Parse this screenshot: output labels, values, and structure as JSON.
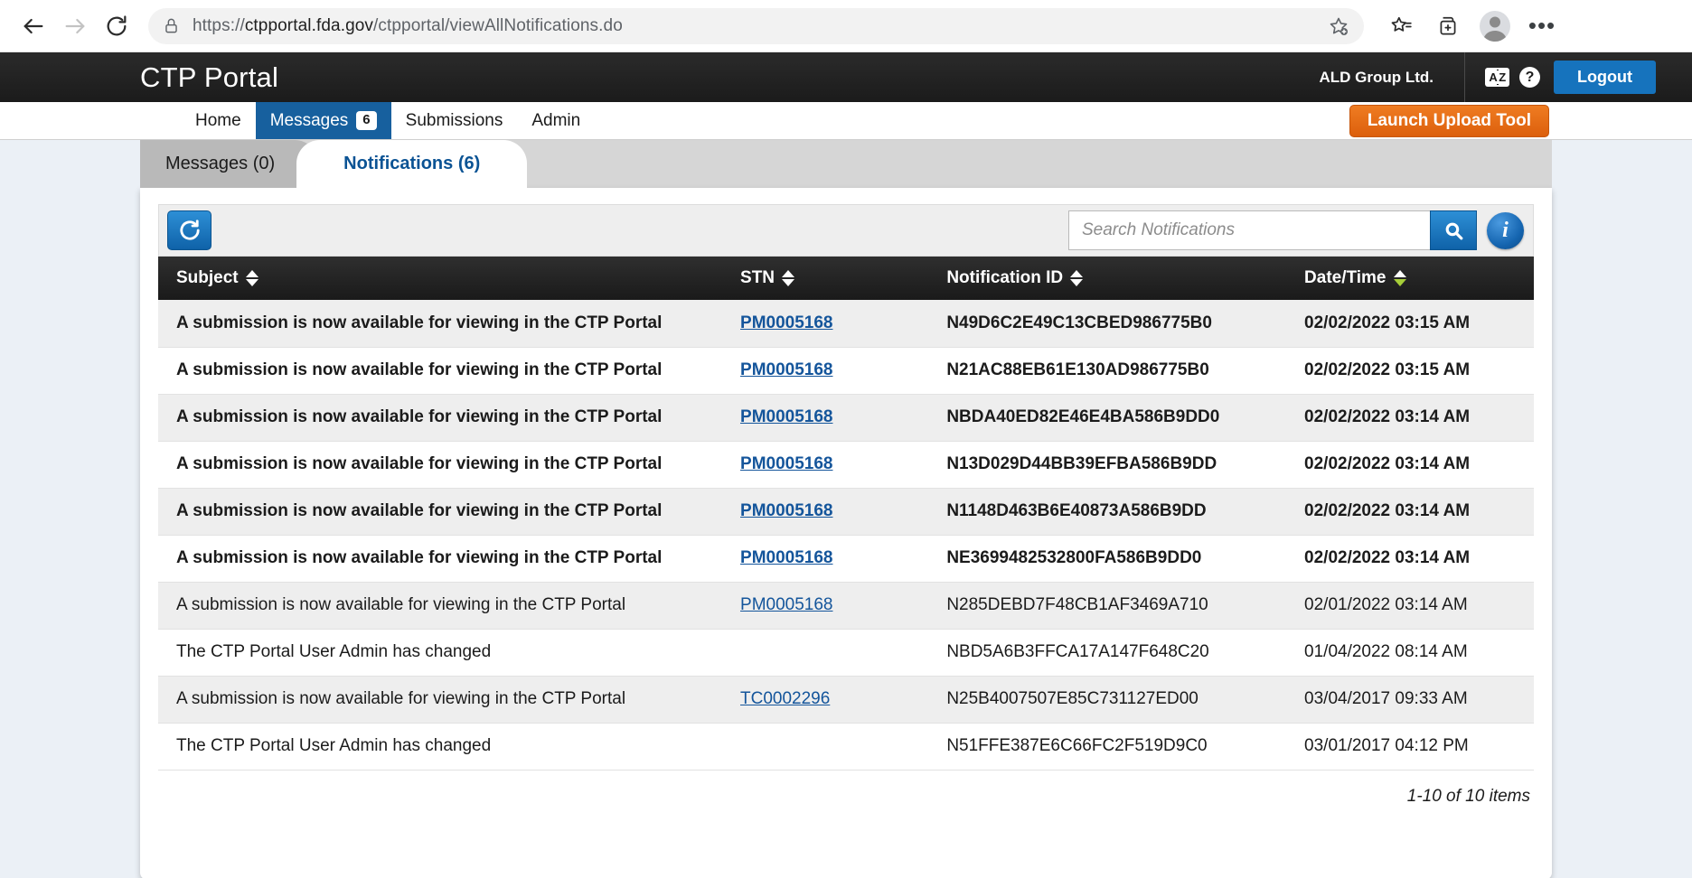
{
  "browser": {
    "url_scheme": "https://",
    "url_host": "ctpportal.fda.gov",
    "url_path": "/ctpportal/viewAllNotifications.do",
    "back_icon": "back-arrow-icon",
    "forward_icon": "forward-arrow-icon",
    "reload_icon": "reload-icon",
    "lock_icon": "lock-icon",
    "add_favorite_icon": "add-favorite-star-icon",
    "favorites_icon": "favorites-list-icon",
    "collections_icon": "collections-icon",
    "profile_icon": "profile-avatar-icon",
    "settings_icon": "more-options-ellipsis-icon",
    "settings_label": "•••"
  },
  "header": {
    "app_title": "CTP Portal",
    "org_name": "ALD Group Ltd.",
    "glossary_icon_label": "AZ",
    "glossary_icon_a": "A",
    "glossary_icon_z": "Z",
    "help_icon_label": "?",
    "logout_label": "Logout",
    "logo_color": "#1b1b1b",
    "logout_color": "#1673bd"
  },
  "nav": {
    "items": [
      {
        "label": "Home",
        "badge": null,
        "active": false
      },
      {
        "label": "Messages",
        "badge": "6",
        "active": true
      },
      {
        "label": "Submissions",
        "badge": null,
        "active": false
      },
      {
        "label": "Admin",
        "badge": null,
        "active": false
      }
    ],
    "upload_button_label": "Launch Upload Tool",
    "upload_button_color": "#e2690f",
    "active_color": "#17609e"
  },
  "tabs": [
    {
      "label": "Messages (0)",
      "active": false
    },
    {
      "label": "Notifications (6)",
      "active": true
    }
  ],
  "toolbar": {
    "refresh_icon": "refresh-icon",
    "search_placeholder": "Search Notifications",
    "search_value": "",
    "search_icon": "search-magnifier-icon",
    "info_icon": "info-icon",
    "info_label": "i"
  },
  "table": {
    "columns": [
      {
        "key": "subject",
        "label": "Subject",
        "sort": "none"
      },
      {
        "key": "stn",
        "label": "STN",
        "sort": "none"
      },
      {
        "key": "notification_id",
        "label": "Notification ID",
        "sort": "none"
      },
      {
        "key": "datetime",
        "label": "Date/Time",
        "sort": "desc"
      }
    ],
    "rows": [
      {
        "subject": "A submission is now available for viewing in the CTP Portal",
        "stn": "PM0005168",
        "notification_id": "N49D6C2E49C13CBED986775B0",
        "datetime": "02/02/2022 03:15 AM",
        "unread": true
      },
      {
        "subject": "A submission is now available for viewing in the CTP Portal",
        "stn": "PM0005168",
        "notification_id": "N21AC88EB61E130AD986775B0",
        "datetime": "02/02/2022 03:15 AM",
        "unread": true
      },
      {
        "subject": "A submission is now available for viewing in the CTP Portal",
        "stn": "PM0005168",
        "notification_id": "NBDA40ED82E46E4BA586B9DD0",
        "datetime": "02/02/2022 03:14 AM",
        "unread": true
      },
      {
        "subject": "A submission is now available for viewing in the CTP Portal",
        "stn": "PM0005168",
        "notification_id": "N13D029D44BB39EFBA586B9DD",
        "datetime": "02/02/2022 03:14 AM",
        "unread": true
      },
      {
        "subject": "A submission is now available for viewing in the CTP Portal",
        "stn": "PM0005168",
        "notification_id": "N1148D463B6E40873A586B9DD",
        "datetime": "02/02/2022 03:14 AM",
        "unread": true
      },
      {
        "subject": "A submission is now available for viewing in the CTP Portal",
        "stn": "PM0005168",
        "notification_id": "NE3699482532800FA586B9DD0",
        "datetime": "02/02/2022 03:14 AM",
        "unread": true
      },
      {
        "subject": "A submission is now available for viewing in the CTP Portal",
        "stn": "PM0005168",
        "notification_id": "N285DEBD7F48CB1AF3469A710",
        "datetime": "02/01/2022 03:14 AM",
        "unread": false
      },
      {
        "subject": "The CTP Portal User Admin has changed",
        "stn": "",
        "notification_id": "NBD5A6B3FFCA17A147F648C20",
        "datetime": "01/04/2022 08:14 AM",
        "unread": false
      },
      {
        "subject": "A submission is now available for viewing in the CTP Portal",
        "stn": "TC0002296",
        "notification_id": "N25B4007507E85C731127ED00",
        "datetime": "03/04/2017 09:33 AM",
        "unread": false
      },
      {
        "subject": "The CTP Portal User Admin has changed",
        "stn": "",
        "notification_id": "N51FFE387E6C66FC2F519D9C0",
        "datetime": "03/01/2017 04:12 PM",
        "unread": false
      }
    ],
    "footer_count": "1-10 of 10 items"
  }
}
